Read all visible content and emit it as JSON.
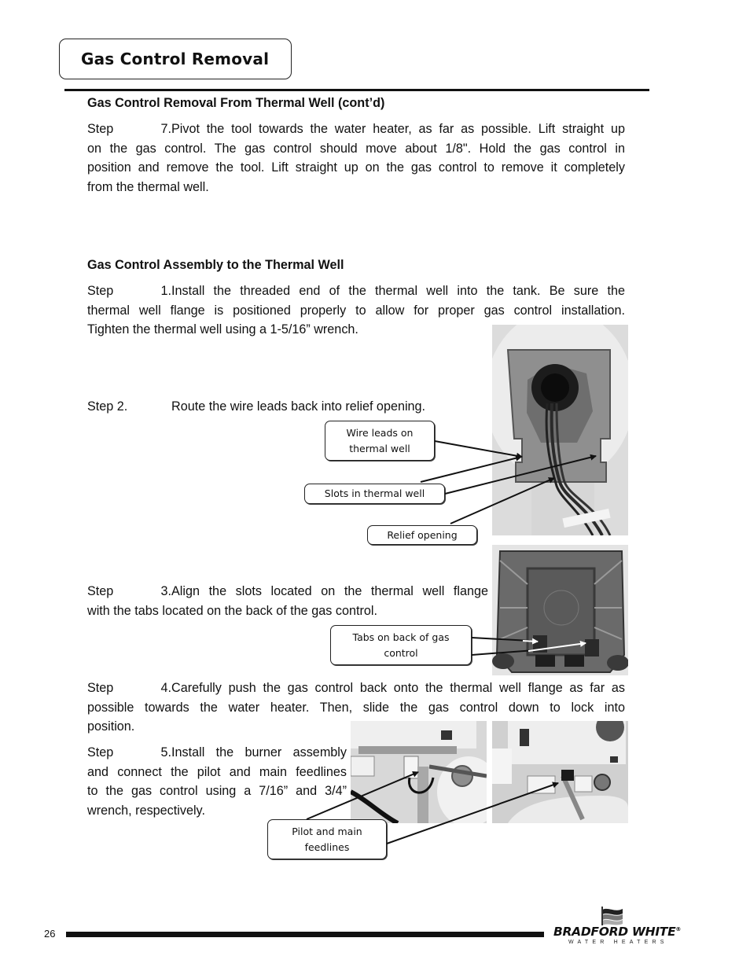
{
  "header": {
    "title": "Gas Control Removal"
  },
  "section1": {
    "heading": "Gas Control Removal From Thermal Well (cont’d)",
    "step7": {
      "label": "Step 7.",
      "lines": [
        "Pivot the tool towards the water heater, as far as possible.  Lift straight up",
        "on the gas control.  The gas control should move about 1/8\".  Hold the gas control in",
        "position and remove the tool.  Lift straight up on the gas control to remove it completely",
        "from the thermal well."
      ]
    }
  },
  "section2": {
    "heading": "Gas Control Assembly to the Thermal Well",
    "step1": {
      "label": "Step 1.",
      "lines": [
        "Install the threaded end of the thermal well into the tank. Be sure the",
        "thermal well flange is positioned properly to allow for proper gas control installation.",
        "Tighten the thermal well using a 1-5/16” wrench."
      ]
    },
    "step2": {
      "label": "Step 2.",
      "text": "Route the wire leads back into relief opening."
    },
    "step3": {
      "label": "Step 3.",
      "lines": [
        "Align the slots located on the thermal well flange",
        "with the tabs located on the back of the gas control."
      ]
    },
    "step4": {
      "label": "Step 4.",
      "lines": [
        "Carefully push the gas control back onto the thermal well flange as far as",
        "possible towards the water heater.  Then, slide the gas control down to lock into",
        "position."
      ]
    },
    "step5": {
      "label": "Step 5.",
      "lines": [
        "Install the burner assembly",
        "and connect the pilot and main feedlines",
        "to the gas control using a 7/16” and 3/4”",
        "wrench, respectively."
      ]
    }
  },
  "callouts": {
    "wire_leads": [
      "Wire leads on",
      "thermal well"
    ],
    "slots": "Slots in thermal well",
    "relief": "Relief opening",
    "tabs": [
      "Tabs on back of gas",
      "control"
    ],
    "feedlines": [
      "Pilot and main",
      "feedlines"
    ]
  },
  "photos": {
    "thermal_well": "thermal-well-flange-photo",
    "gas_control_back": "gas-control-back-photo",
    "feedline_left": "pilot-feedline-photo",
    "feedline_right": "main-feedline-photo"
  },
  "footer": {
    "page_number": "26",
    "brand": "BRADFORD WHITE",
    "brand_mark": "®",
    "brand_sub": "WATER HEATERS"
  }
}
